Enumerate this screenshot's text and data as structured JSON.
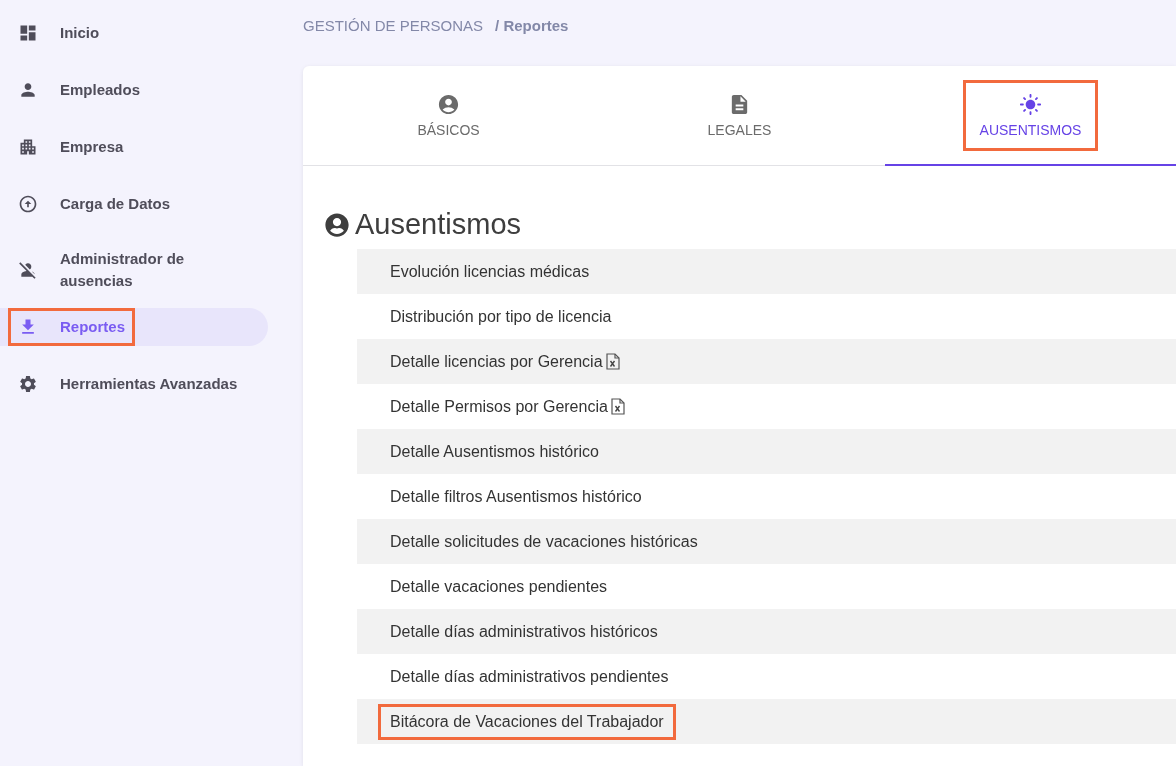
{
  "sidebar": {
    "items": [
      {
        "label": "Inicio",
        "selected": false,
        "highlighted": false
      },
      {
        "label": "Empleados",
        "selected": false,
        "highlighted": false
      },
      {
        "label": "Empresa",
        "selected": false,
        "highlighted": false
      },
      {
        "label": "Carga de Datos",
        "selected": false,
        "highlighted": false
      },
      {
        "label": "Administrador de ausencias",
        "selected": false,
        "highlighted": false
      },
      {
        "label": "Reportes",
        "selected": true,
        "highlighted": true
      },
      {
        "label": "Herramientas Avanzadas",
        "selected": false,
        "highlighted": false
      }
    ]
  },
  "breadcrumb": {
    "section": "GESTIÓN DE PERSONAS",
    "separator": "/",
    "current": "Reportes"
  },
  "tabs": [
    {
      "label": "BÁSICOS",
      "selected": false,
      "highlighted": false
    },
    {
      "label": "LEGALES",
      "selected": false,
      "highlighted": false
    },
    {
      "label": "AUSENTISMOS",
      "selected": true,
      "highlighted": true
    }
  ],
  "section": {
    "title": "Ausentismos"
  },
  "reports": [
    {
      "label": "Evolución licencias médicas",
      "kind": "plain",
      "highlighted": false
    },
    {
      "label": "Distribución por tipo de licencia",
      "kind": "plain",
      "highlighted": false
    },
    {
      "label": "Detalle licencias por Gerencia",
      "kind": "excel",
      "highlighted": false
    },
    {
      "label": "Detalle Permisos por Gerencia",
      "kind": "excel",
      "highlighted": false
    },
    {
      "label": "Detalle Ausentismos histórico",
      "kind": "plain",
      "highlighted": false
    },
    {
      "label": "Detalle filtros Ausentismos histórico",
      "kind": "plain",
      "highlighted": false
    },
    {
      "label": "Detalle solicitudes de vacaciones históricas",
      "kind": "plain",
      "highlighted": false
    },
    {
      "label": "Detalle vacaciones pendientes",
      "kind": "plain",
      "highlighted": false
    },
    {
      "label": "Detalle días administrativos históricos",
      "kind": "plain",
      "highlighted": false
    },
    {
      "label": "Detalle días administrativos pendientes",
      "kind": "plain",
      "highlighted": false
    },
    {
      "label": "Bitácora de Vacaciones del Trabajador",
      "kind": "plain",
      "highlighted": true
    }
  ]
}
